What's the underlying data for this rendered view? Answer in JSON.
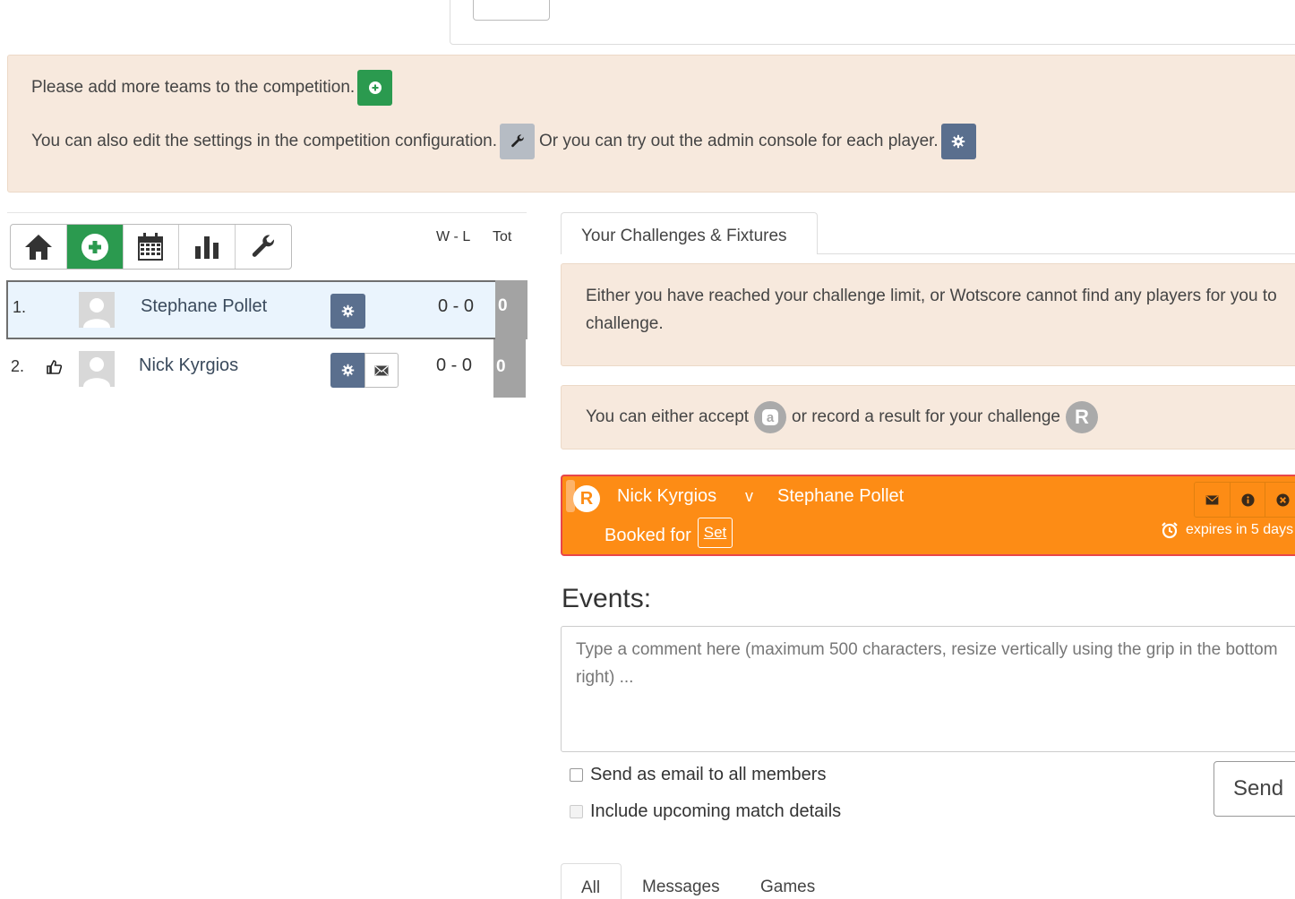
{
  "alert": {
    "line1": "Please add more teams to the competition.",
    "line2a": "You can also edit the settings in the competition configuration.",
    "line2b": "Or you can try out the admin console for each player."
  },
  "standings": {
    "toolbar": [
      {
        "icon": "home-icon"
      },
      {
        "icon": "add-circle-icon",
        "active": true
      },
      {
        "icon": "calendar-icon"
      },
      {
        "icon": "bar-chart-icon"
      },
      {
        "icon": "wrench-icon"
      }
    ],
    "columns": {
      "wl": "W - L",
      "tot": "Tot"
    },
    "rows": [
      {
        "rank": "1.",
        "name": "Stephane Pollet",
        "wl": "0 - 0",
        "tot": "0"
      },
      {
        "rank": "2.",
        "name": "Nick Kyrgios",
        "wl": "0 - 0",
        "tot": "0"
      }
    ]
  },
  "challenges": {
    "tab_label": "Your Challenges & Fixtures",
    "info_limit": "Either you have reached your challenge limit, or Wotscore cannot find any players for you to challenge.",
    "info_accept_a": "You can either accept",
    "info_accept_b": "or record a result for your challenge",
    "accept_icon_letter": "a",
    "record_icon_letter": "R",
    "match": {
      "badge": "R",
      "player1": "Nick Kyrgios",
      "vs": "v",
      "player2": "Stephane Pollet",
      "booked_label": "Booked for",
      "set_label": "Set",
      "expires": "expires in 5 days"
    }
  },
  "events": {
    "title": "Events:",
    "comment_placeholder": "Type a comment here (maximum 500 characters, resize vertically using the grip in the bottom right) ...",
    "email_all_label": "Send as email to all members",
    "include_upcoming_label": "Include upcoming match details",
    "send_label": "Send",
    "tabs": [
      "All",
      "Messages",
      "Games"
    ]
  },
  "colors": {
    "accent_green": "#2b9a4f",
    "slate_button": "#5a6f8e",
    "alert_bg": "#f7e9dd",
    "match_orange": "#fd8c15",
    "match_border": "#e8464a",
    "tot_grey": "#a3a3a3"
  }
}
